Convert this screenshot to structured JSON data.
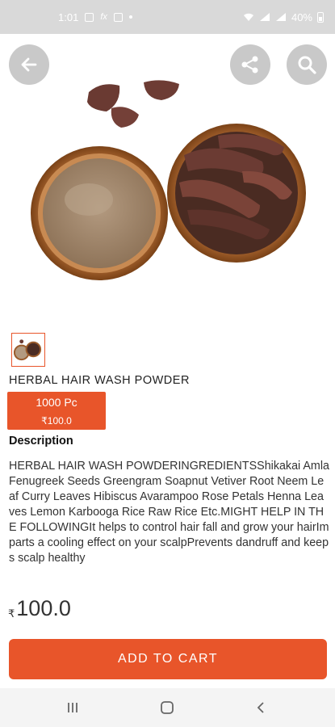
{
  "status_bar": {
    "time": "1:01",
    "battery_percent": "40%"
  },
  "icons": {
    "back": "arrow-left-icon",
    "share": "share-icon",
    "search": "search-icon"
  },
  "product": {
    "title": "HERBAL HAIR WASH POWDER",
    "variant": {
      "quantity": "1000 Pc",
      "price": "₹100.0"
    },
    "description_heading": "Description",
    "description": "HERBAL HAIR WASH POWDERINGREDIENTSShikakai Amla Fenugreek Seeds Greengram Soapnut Vetiver Root Neem Leaf Curry Leaves Hibiscus Avarampoo Rose Petals Henna Leaves Lemon Karbooga Rice Raw Rice Etc.MIGHT HELP IN THE FOLLOWINGIt helps to control hair fall and grow your hairImparts a cooling effect on your scalpPrevents dandruff and keeps scalp healthy",
    "price_currency": "₹",
    "price_value": "100.0"
  },
  "actions": {
    "add_to_cart": "ADD TO CART"
  },
  "colors": {
    "accent": "#e8552a",
    "status_bar": "#d9d9d9",
    "icon_button": "#c9c9c9"
  }
}
